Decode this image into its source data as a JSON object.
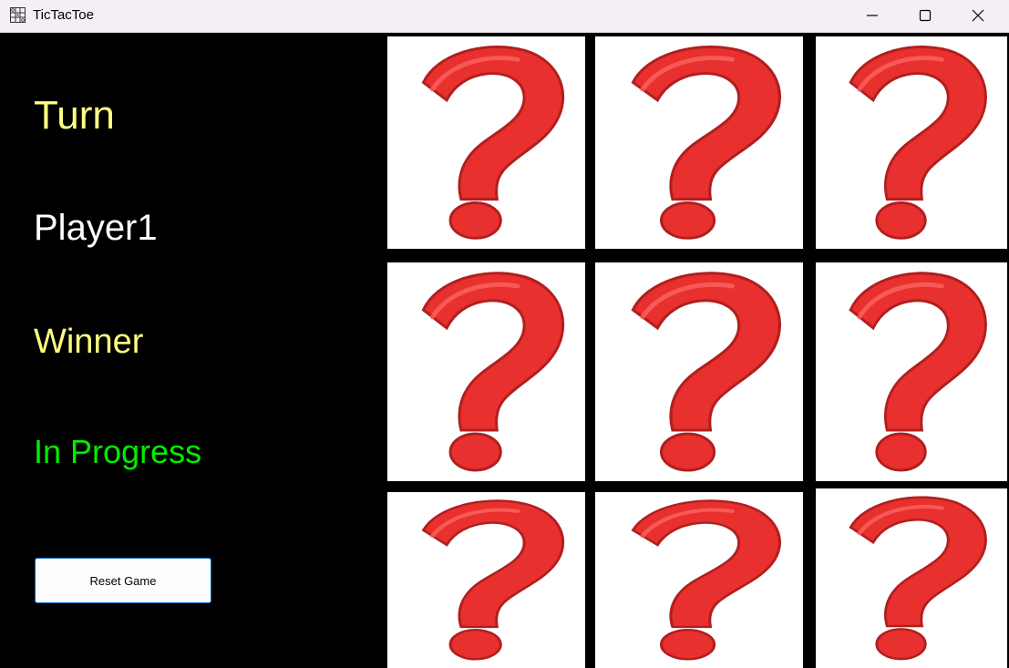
{
  "window": {
    "title": "TicTacToe"
  },
  "status_panel": {
    "turn_label": "Turn",
    "current_player": "Player1",
    "winner_label": "Winner",
    "winner_value": "In Progress",
    "reset_button": "Reset Game"
  },
  "colors": {
    "label_yellow": "#ffff80",
    "player_white": "#ffffff",
    "status_green": "#00ee00",
    "question_red": "#e8302e",
    "panel_bg": "#000000"
  },
  "board": {
    "cells": [
      {
        "state": "unplayed",
        "icon": "question-mark-icon"
      },
      {
        "state": "unplayed",
        "icon": "question-mark-icon"
      },
      {
        "state": "unplayed",
        "icon": "question-mark-icon"
      },
      {
        "state": "unplayed",
        "icon": "question-mark-icon"
      },
      {
        "state": "unplayed",
        "icon": "question-mark-icon"
      },
      {
        "state": "unplayed",
        "icon": "question-mark-icon"
      },
      {
        "state": "unplayed",
        "icon": "question-mark-icon"
      },
      {
        "state": "unplayed",
        "icon": "question-mark-icon"
      },
      {
        "state": "unplayed",
        "icon": "question-mark-icon"
      }
    ]
  }
}
